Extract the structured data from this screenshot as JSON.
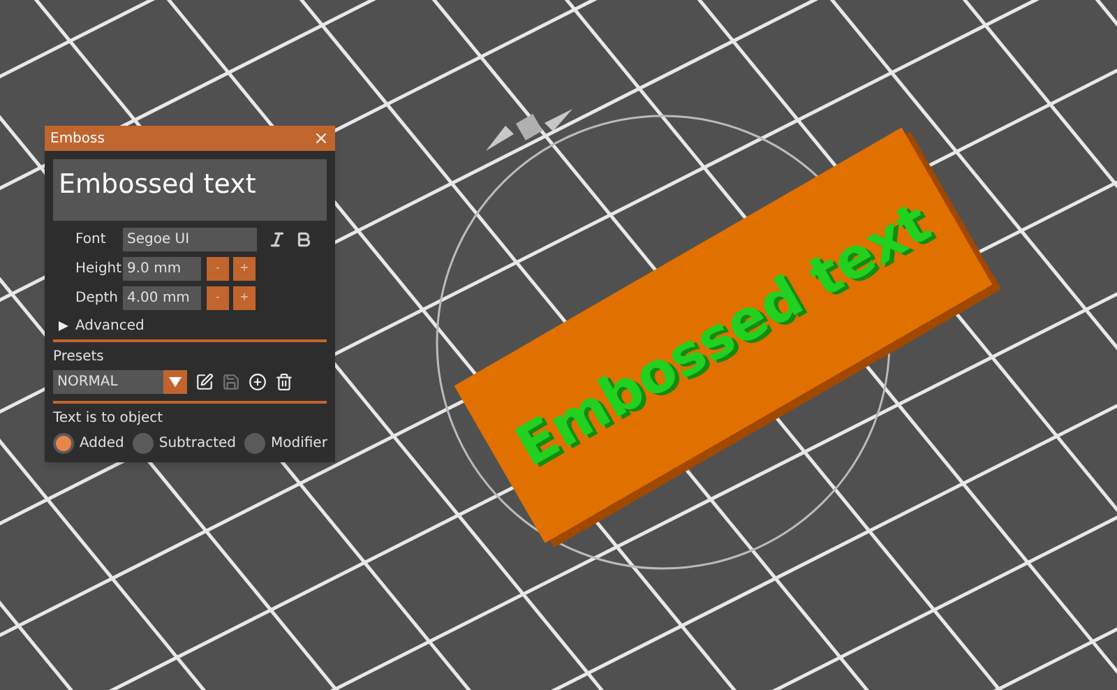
{
  "viewport": {
    "plate_text": "Embossed text"
  },
  "panel": {
    "title": "Emboss",
    "text_value": "Embossed text",
    "fields": [
      {
        "kind": "font",
        "label": "Font",
        "value": "Segoe UI"
      },
      {
        "kind": "stepper",
        "label": "Height",
        "value": "9.0 mm",
        "minus": "-",
        "plus": "+"
      },
      {
        "kind": "stepper",
        "label": "Depth",
        "value": "4.00 mm",
        "minus": "-",
        "plus": "+"
      }
    ],
    "advanced": {
      "label": "Advanced",
      "expanded": false
    },
    "presets": {
      "label": "Presets",
      "value": "NORMAL"
    },
    "text_is_to_object": {
      "label": "Text is to object",
      "options": [
        {
          "label": "Added",
          "selected": true
        },
        {
          "label": "Subtracted",
          "selected": false
        },
        {
          "label": "Modifier",
          "selected": false
        }
      ]
    }
  }
}
